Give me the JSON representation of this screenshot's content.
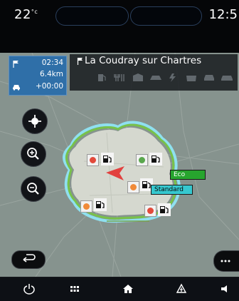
{
  "status_bar": {
    "temperature": "22",
    "temperature_unit": "°c",
    "time": "12:5"
  },
  "trip": {
    "arrival_time": "02:34",
    "distance": "6.4km",
    "delay": "+00:00"
  },
  "destination": {
    "name": "La Coudray sur Chartres"
  },
  "map_labels": {
    "eco": "Eco",
    "standard": "Standard"
  },
  "markers": [
    {
      "color": "#e24a3b"
    },
    {
      "color": "#5aa74d"
    },
    {
      "color": "#f08a39"
    },
    {
      "color": "#f08a39"
    },
    {
      "color": "#e24a3b"
    }
  ],
  "colors": {
    "accent": "#2f6fa8",
    "route_arrow": "#e2413f",
    "eco": "#27a52e",
    "standard": "#36c8cf"
  },
  "nav_icons": [
    "power-icon",
    "apps-icon",
    "home-icon",
    "navigation-icon",
    "volume-icon"
  ]
}
